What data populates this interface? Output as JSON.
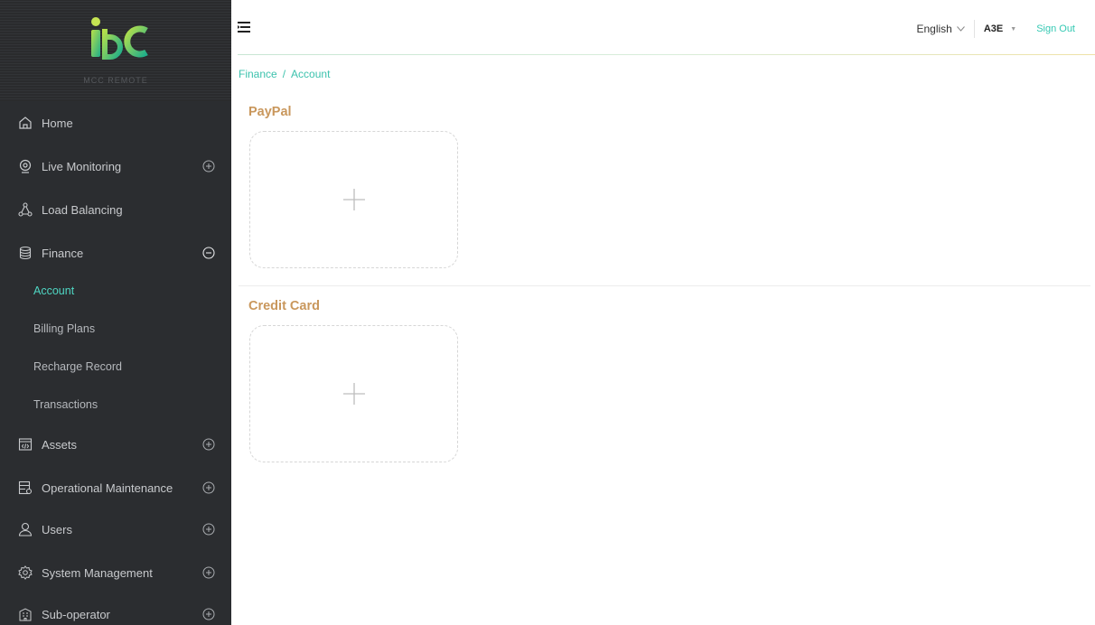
{
  "logo": {
    "caption": "MCC REMOTE"
  },
  "sidebar": {
    "items": [
      {
        "label": "Home",
        "icon": "home-icon"
      },
      {
        "label": "Live Monitoring",
        "icon": "webcam-icon",
        "toggle": "expand"
      },
      {
        "label": "Load Balancing",
        "icon": "network-icon"
      },
      {
        "label": "Finance",
        "icon": "database-icon",
        "toggle": "collapse"
      },
      {
        "label": "Assets",
        "icon": "code-window-icon",
        "toggle": "expand"
      },
      {
        "label": "Operational Maintenance",
        "icon": "server-settings-icon",
        "toggle": "expand"
      },
      {
        "label": "Users",
        "icon": "user-icon",
        "toggle": "expand"
      },
      {
        "label": "System Management",
        "icon": "gear-icon",
        "toggle": "expand"
      },
      {
        "label": "Sub-operator",
        "icon": "building-icon",
        "toggle": "expand"
      }
    ],
    "finance_sub": [
      {
        "label": "Account",
        "active": true
      },
      {
        "label": "Billing Plans"
      },
      {
        "label": "Recharge Record"
      },
      {
        "label": "Transactions"
      }
    ]
  },
  "header": {
    "language": "English",
    "user": "A3E",
    "sign_out": "Sign Out"
  },
  "breadcrumb": {
    "parent": "Finance",
    "separator": "/",
    "current": "Account"
  },
  "sections": [
    {
      "title": "PayPal"
    },
    {
      "title": "Credit Card"
    }
  ],
  "colors": {
    "sidebar_bg": "#2b2d30",
    "accent": "#3cc2ad",
    "section_title": "#c9975c"
  }
}
